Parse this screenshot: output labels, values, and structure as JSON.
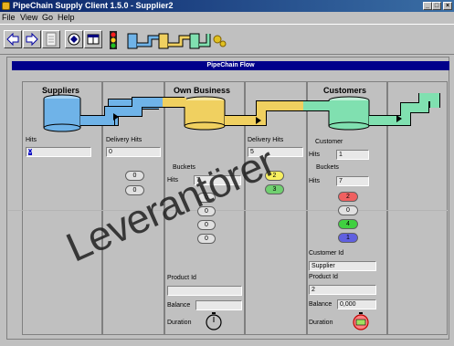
{
  "window": {
    "title": "PipeChain Supply Client 1.5.0 - Supplier2",
    "controls": [
      "_",
      "□",
      "×"
    ]
  },
  "menu": [
    "File",
    "View",
    "Go",
    "Help"
  ],
  "toolbar": {
    "icons": [
      "back-arrow-icon",
      "forward-arrow-icon",
      "document-icon",
      "network-icon",
      "window-icon",
      "traffic-light-icon",
      "pipes-icon"
    ]
  },
  "flow": {
    "header": "PipeChain Flow",
    "suppliers": {
      "title": "Suppliers",
      "hits_label": "Hits",
      "hits_value": "0"
    },
    "delivery1": {
      "label": "Delivery Hits",
      "value": "0",
      "buckets": [
        "0",
        "0"
      ]
    },
    "own": {
      "title": "Own Business",
      "buckets_label": "Buckets",
      "hits_label": "Hits",
      "hits_value": "7",
      "buckets": [
        "0",
        "0",
        "0",
        "0"
      ],
      "product_id_label": "Product Id",
      "product_id_value": "",
      "balance_label": "Balance",
      "balance_value": "",
      "duration_label": "Duration"
    },
    "delivery2": {
      "label": "Delivery Hits",
      "value": "5",
      "buckets": [
        "2",
        "3"
      ]
    },
    "customers": {
      "title": "Customers",
      "customer_label": "Customer",
      "hits_label": "Hits",
      "hits_value": "1",
      "buckets_label": "Buckets",
      "buckets_hits_label": "Hits",
      "buckets_hits_value": "7",
      "buckets": [
        "2",
        "0",
        "4",
        "1"
      ],
      "customer_id_label": "Customer Id",
      "customer_id_value": "Supplier",
      "product_id_label": "Product Id",
      "product_id_value": "2",
      "balance_label": "Balance",
      "balance_value": "0,000",
      "duration_label": "Duration"
    }
  },
  "watermark": "Leverantörer",
  "colors": {
    "supplier_pipe": "#6fb3e8",
    "own_pipe": "#f0d060",
    "customer_pipe": "#80e0b0",
    "header_bg": "#00008b"
  }
}
